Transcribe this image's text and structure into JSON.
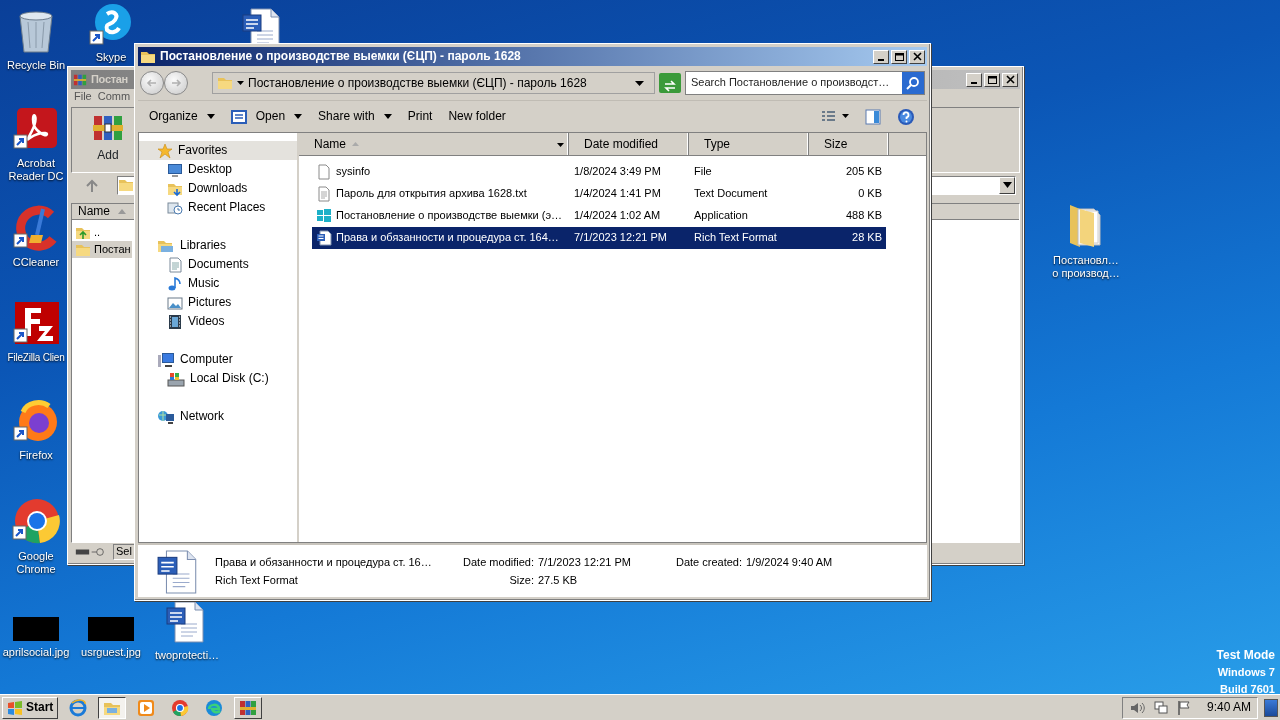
{
  "desktop_icons": [
    {
      "label": "Recycle Bin",
      "kind": "recycle"
    },
    {
      "label": "Skype",
      "kind": "skype"
    },
    {
      "kind": "word"
    },
    {
      "label": "Acrobat Reader DC",
      "kind": "acrobat"
    },
    {
      "label": "CCleaner",
      "kind": "ccleaner"
    },
    {
      "label": "FileZilla Clien",
      "kind": "filezilla"
    },
    {
      "label": "Firefox",
      "kind": "firefox"
    },
    {
      "label": "Google Chrome",
      "kind": "chrome"
    },
    {
      "label": "aprilsocial.jpg",
      "kind": "thumbnail"
    },
    {
      "label": "usrguest.jpg",
      "kind": "thumbnail"
    },
    {
      "label": "twoprotecti…",
      "kind": "word"
    },
    {
      "label": "Постановл…\nо производ…",
      "kind": "folder"
    }
  ],
  "archiver_window": {
    "title": "Постан",
    "menu": [
      "File",
      "Comm"
    ],
    "toolbar": [
      "Add"
    ],
    "list_header": "Name",
    "rows": [
      {
        "name": "..",
        "kind": "up",
        "selected": false
      },
      {
        "name": "Постан",
        "kind": "folder",
        "selected": true
      }
    ],
    "status": "Sel"
  },
  "explorer_window": {
    "title": "Постановление о производстве выемки (ЄЦП) - пароль 1628",
    "address": "Постановление о производстве выемки (ЄЦП) - пароль 1628",
    "search": {
      "placeholder": "Search Постановление о производст…"
    },
    "toolbar": [
      {
        "label": "Organize",
        "kind": "text",
        "dropdown": true
      },
      {
        "label": "Open",
        "kind": "icon",
        "dropdown": true
      },
      {
        "label": "Share with",
        "kind": "text",
        "dropdown": true
      },
      {
        "label": "Print",
        "kind": "text",
        "dropdown": false
      },
      {
        "label": "New folder",
        "kind": "text",
        "dropdown": false
      }
    ],
    "nav": [
      {
        "label": "Favorites",
        "kind": "star",
        "highlighted": true,
        "children": [
          {
            "label": "Desktop",
            "kind": "desktop"
          },
          {
            "label": "Downloads",
            "kind": "downloads"
          },
          {
            "label": "Recent Places",
            "kind": "recent"
          }
        ]
      },
      {
        "label": "Libraries",
        "kind": "libraries",
        "highlighted": false,
        "children": [
          {
            "label": "Documents",
            "kind": "documents"
          },
          {
            "label": "Music",
            "kind": "music"
          },
          {
            "label": "Pictures",
            "kind": "pictures"
          },
          {
            "label": "Videos",
            "kind": "videos"
          }
        ]
      },
      {
        "label": "Computer",
        "kind": "computer",
        "highlighted": false,
        "children": [
          {
            "label": "Local Disk (C:)",
            "kind": "drive"
          }
        ]
      },
      {
        "label": "Network",
        "kind": "network",
        "highlighted": false
      }
    ],
    "columns": [
      {
        "label": "Name",
        "sorted": true
      },
      {
        "label": "Date modified",
        "sorted": false
      },
      {
        "label": "Type",
        "sorted": false
      },
      {
        "label": "Size",
        "sorted": false
      }
    ],
    "files": [
      {
        "name": "sysinfo",
        "date": "1/8/2024 3:49 PM",
        "type": "File",
        "size": "205 KB",
        "kind": "file",
        "selected": false
      },
      {
        "name": "Пароль для открытия архива 1628.txt",
        "date": "1/4/2024 1:41 PM",
        "type": "Text Document",
        "size": "0 KB",
        "kind": "text",
        "selected": false
      },
      {
        "name": "Постановление о производстве выемки (э…",
        "date": "1/4/2024 1:02 AM",
        "type": "Application",
        "size": "488 KB",
        "kind": "app",
        "selected": false
      },
      {
        "name": "Права и обязанности и процедура ст. 164…",
        "date": "7/1/2023 12:21 PM",
        "type": "Rich Text Format",
        "size": "28 KB",
        "kind": "rtf",
        "selected": true
      }
    ],
    "details": {
      "name": "Права и обязанности и процедура ст. 16…",
      "type": "Rich Text Format",
      "fields": [
        {
          "label": "Date modified:",
          "value": "7/1/2023 12:21 PM"
        },
        {
          "label": "Size:",
          "value": "27.5 KB"
        },
        {
          "label": "Date created:",
          "value": "1/9/2024 9:40 AM"
        }
      ]
    }
  },
  "taskbar": {
    "start": "Start",
    "tasks": [
      {
        "kind": "ie",
        "open": false,
        "active": false
      },
      {
        "kind": "explorer",
        "open": true,
        "active": true
      },
      {
        "kind": "media",
        "open": false,
        "active": false
      },
      {
        "kind": "chrome",
        "open": false,
        "active": false
      },
      {
        "kind": "edge",
        "open": false,
        "active": false
      },
      {
        "kind": "winrar",
        "open": true,
        "active": false
      }
    ],
    "clock": "9:40 AM"
  },
  "system_notice": [
    "Test Mode",
    "Windows 7",
    "Build 7601"
  ]
}
